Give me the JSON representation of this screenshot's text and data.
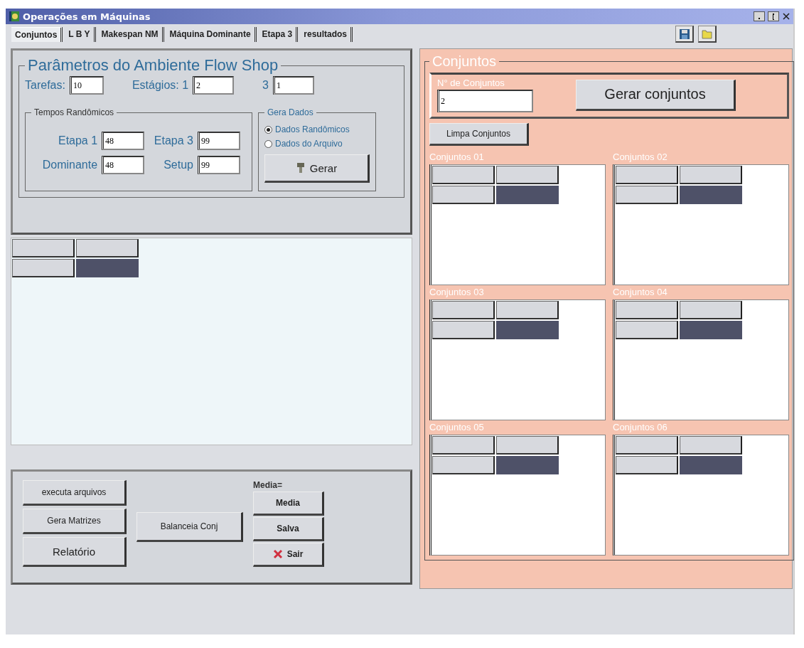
{
  "window": {
    "title": "Operações em Máquinas"
  },
  "tabs": [
    {
      "label": "Conjuntos",
      "selected": true
    },
    {
      "label": "L B Y",
      "selected": false
    },
    {
      "label": "Makespan NM",
      "selected": false
    },
    {
      "label": "Máquina Dominante",
      "selected": false
    },
    {
      "label": "Etapa 3",
      "selected": false
    },
    {
      "label": "resultados",
      "selected": false
    }
  ],
  "parameters": {
    "title": "Parâmetros do Ambiente Flow Shop",
    "fields": [
      {
        "label": "Tarefas:",
        "value": "10"
      },
      {
        "label": "Estágios: 1",
        "value": "2"
      },
      {
        "label": "3",
        "value": "1"
      }
    ],
    "random_times": {
      "title": "Tempos Randômicos",
      "fields": [
        {
          "label": "Etapa 1",
          "value": "48"
        },
        {
          "label": "Etapa 3",
          "value": "99"
        },
        {
          "label": "Dominante",
          "value": "48"
        },
        {
          "label": "Setup",
          "value": "99"
        }
      ]
    },
    "data_source": {
      "title": "Gera Dados",
      "options": [
        {
          "label": "Dados Randômicos",
          "selected": true
        },
        {
          "label": "Dados do Arquivo",
          "selected": false
        }
      ],
      "button": "Gerar"
    }
  },
  "actions": {
    "left_buttons": [
      "executa arquivos",
      "Gera Matrizes",
      "Relatório"
    ],
    "middle_button": "Balanceia Conj",
    "media_label": "Media=",
    "right_buttons": [
      {
        "label": "Media",
        "kind": "plain"
      },
      {
        "label": "Salva",
        "kind": "plain"
      },
      {
        "label": "Sair",
        "kind": "exit"
      }
    ]
  },
  "sets": {
    "title": "Conjuntos",
    "count_label": "N° de Conjuntos",
    "count_value": "2",
    "generate_button": "Gerar conjuntos",
    "clear_button": "Limpa Conjuntos",
    "grids": [
      {
        "title": "Conjuntos 01"
      },
      {
        "title": "Conjuntos 02"
      },
      {
        "title": "Conjuntos 03"
      },
      {
        "title": "Conjuntos 04"
      },
      {
        "title": "Conjuntos 05"
      },
      {
        "title": "Conjuntos 06"
      }
    ]
  }
}
